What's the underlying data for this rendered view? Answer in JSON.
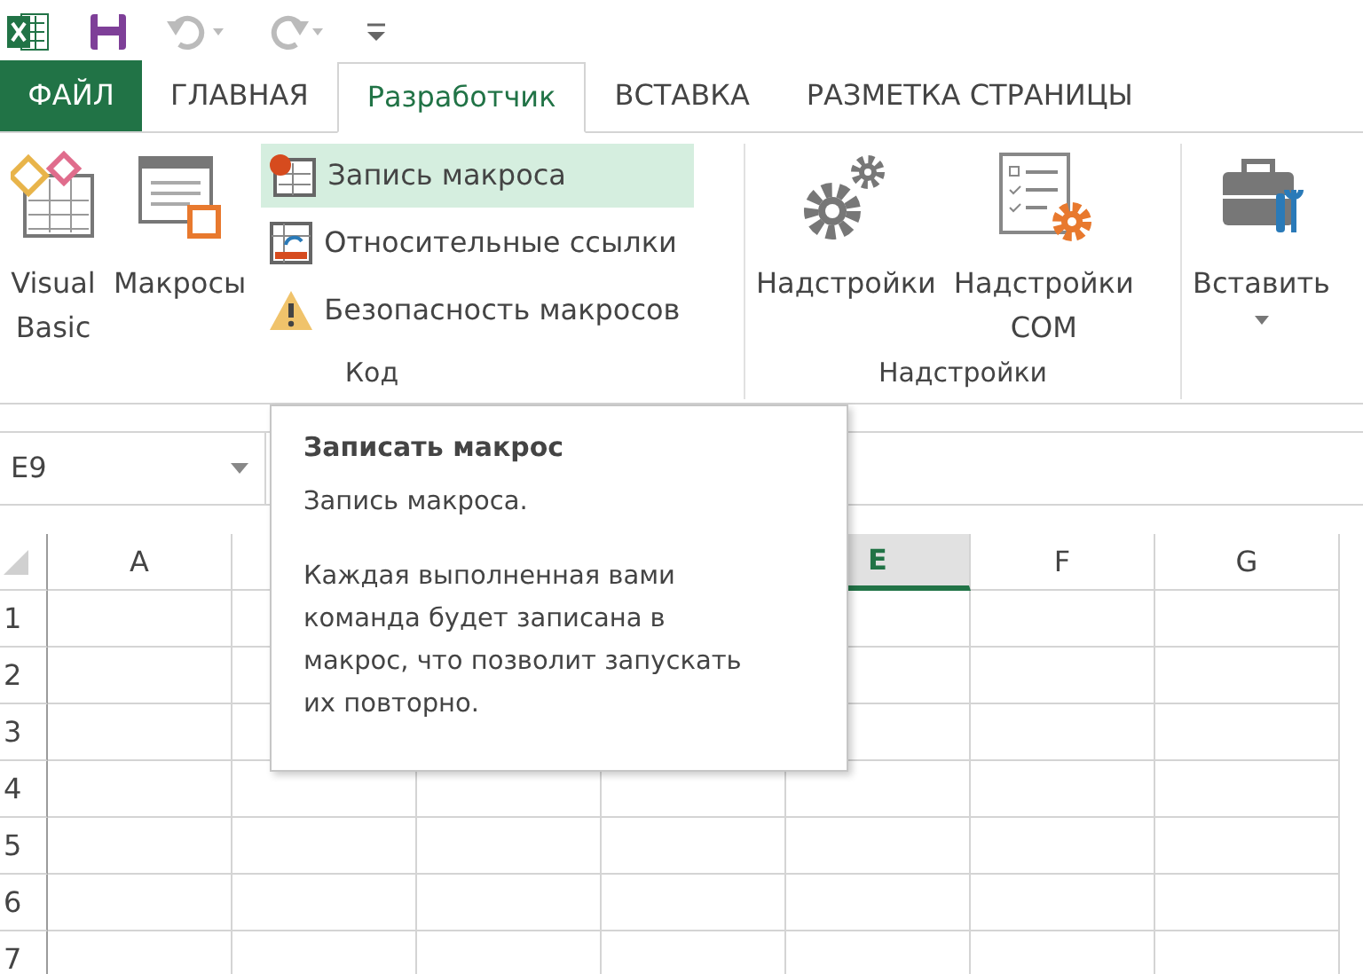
{
  "tabs": [
    {
      "label": "ФАЙЛ",
      "kind": "file",
      "selected": false
    },
    {
      "label": "ГЛАВНАЯ",
      "kind": "tab",
      "selected": false
    },
    {
      "label": "Разработчик",
      "kind": "tab",
      "selected": true
    },
    {
      "label": "ВСТАВКА",
      "kind": "tab",
      "selected": false
    },
    {
      "label": "РАЗМЕТКА СТРАНИЦЫ",
      "kind": "tab",
      "selected": false
    }
  ],
  "ribbon": {
    "groups": [
      {
        "label": "Код",
        "items": [
          {
            "kind": "large",
            "lines": [
              "Visual",
              "Basic"
            ]
          },
          {
            "kind": "large",
            "lines": [
              "Макросы"
            ]
          },
          {
            "kind": "small",
            "label": "Запись макроса",
            "highlighted": true
          },
          {
            "kind": "small",
            "label": "Относительные ссылки",
            "highlighted": false
          },
          {
            "kind": "small",
            "label": "Безопасность макросов",
            "highlighted": false
          }
        ]
      },
      {
        "label": "Надстройки",
        "items": [
          {
            "kind": "large",
            "lines": [
              "Надстройки"
            ]
          },
          {
            "kind": "large",
            "lines": [
              "Надстройки",
              "COM"
            ]
          }
        ]
      },
      {
        "items": [
          {
            "kind": "large",
            "lines": [
              "Вставить"
            ],
            "dropdown": true
          }
        ]
      }
    ]
  },
  "name_box": {
    "value": "E9"
  },
  "grid": {
    "columns": [
      {
        "label": "A",
        "selected": false
      },
      {
        "label": "E",
        "selected": true
      },
      {
        "label": "F",
        "selected": false
      },
      {
        "label": "G",
        "selected": false
      }
    ],
    "rows": [
      "1",
      "2",
      "3",
      "4",
      "5",
      "6",
      "7"
    ]
  },
  "tooltip": {
    "title": "Записать макрос",
    "paragraphs": [
      "Запись макроса.",
      "Каждая выполненная вами команда будет записана в макрос, что позволит запускать их повторно."
    ]
  }
}
